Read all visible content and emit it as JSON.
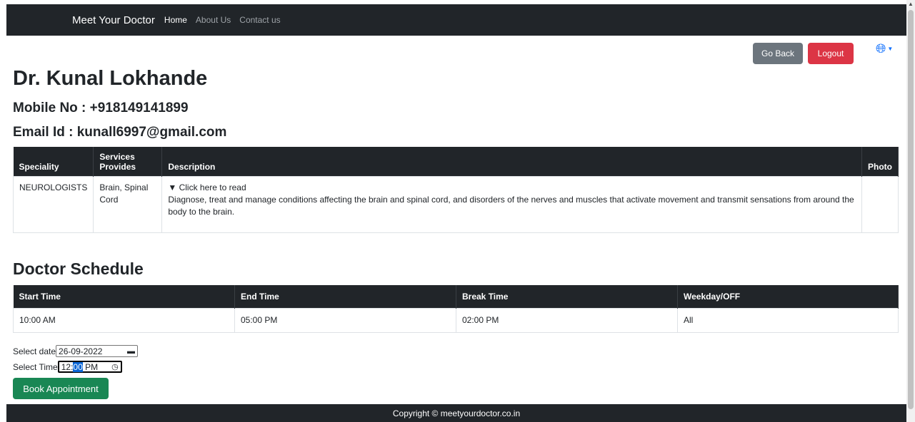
{
  "nav": {
    "brand": "Meet Your Doctor",
    "links": [
      "Home",
      "About Us",
      "Contact us"
    ]
  },
  "actions": {
    "go_back": "Go Back",
    "logout": "Logout",
    "language_icon": "globe-icon"
  },
  "doctor": {
    "name": "Dr. Kunal Lokhande",
    "mobile": "Mobile No : +918149141899",
    "email": "Email Id : kunall6997@gmail.com"
  },
  "details_table": {
    "headers": [
      "Speciality",
      "Services Provides",
      "Description",
      "Photo"
    ],
    "row": {
      "speciality": "NEUROLOGISTS",
      "services": "Brain, Spinal Cord",
      "summary": "▼ Click here to read",
      "description": "Diagnose, treat and manage conditions affecting the brain and spinal cord, and disorders of the nerves and muscles that activate movement and transmit sensations from around the body to the brain.",
      "photo": ""
    }
  },
  "schedule": {
    "title": "Doctor Schedule",
    "headers": [
      "Start Time",
      "End Time",
      "Break Time",
      "Weekday/OFF"
    ],
    "row": [
      "10:00 AM",
      "05:00 PM",
      "02:00 PM",
      "All"
    ]
  },
  "booking": {
    "date_label": "Select date",
    "date_value": "26-09-2022",
    "time_label": "Select Time",
    "time_hour": "12:",
    "time_minute": "00",
    "time_ampm": "PM",
    "button": "Book Appointment"
  },
  "footer": {
    "text": "Copyright © meetyourdoctor.co.in"
  },
  "colors": {
    "navbar": "#212529",
    "go_back": "#6c757d",
    "logout": "#dc3545",
    "book": "#198754",
    "globe": "#0d6efd"
  }
}
